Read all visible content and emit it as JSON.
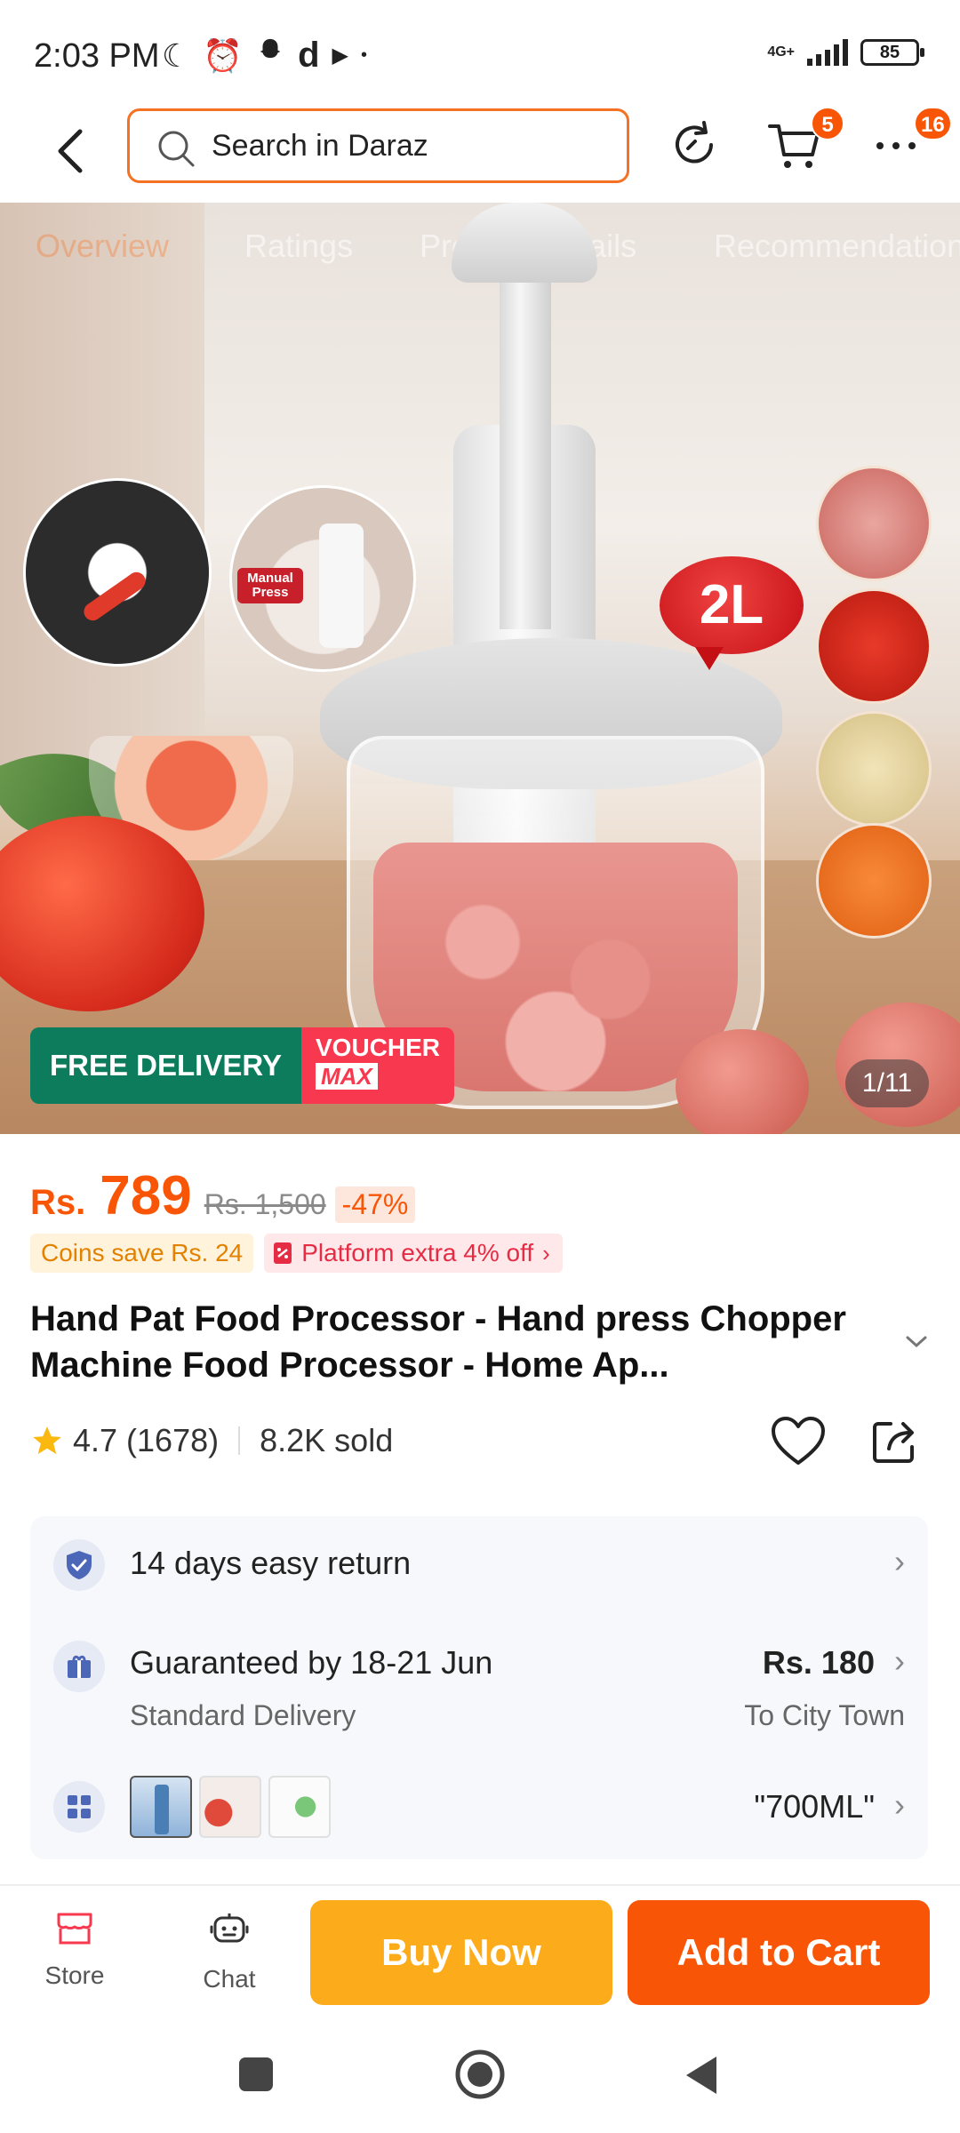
{
  "status_bar": {
    "time": "2:03 PM",
    "network": "4G+",
    "battery": "85"
  },
  "header": {
    "search_placeholder": "Search in Daraz",
    "cart_badge": "5",
    "more_badge": "16"
  },
  "hero": {
    "tabs": [
      "Overview",
      "Ratings",
      "Product Details",
      "Recommendations"
    ],
    "size_label": "2L",
    "inset_label": "Manual Press",
    "free_delivery": "FREE DELIVERY",
    "voucher": "VOUCHER",
    "voucher_max": "MAX",
    "image_counter": "1/11"
  },
  "price": {
    "currency": "Rs.",
    "value": "789",
    "original": "Rs. 1,500",
    "discount": "-47%"
  },
  "promos": {
    "coins": "Coins save Rs. 24",
    "platform": "Platform extra 4% off"
  },
  "product": {
    "title": "Hand Pat Food Processor -  Hand press Chopper Machine Food Processor - Home Ap...",
    "rating": "4.7",
    "rating_count": "(1678)",
    "sold": "8.2K sold"
  },
  "info_card": {
    "return_policy": "14 days easy return",
    "delivery_guarantee": "Guaranteed by 18-21 Jun",
    "delivery_type": "Standard Delivery",
    "delivery_fee": "Rs. 180",
    "delivery_location": "To City Town",
    "variant": "\"700ML\""
  },
  "bottom_bar": {
    "store": "Store",
    "chat": "Chat",
    "buy_now": "Buy Now",
    "add_to_cart": "Add to Cart"
  },
  "colors": {
    "brand_orange": "#f85606",
    "buy_yellow": "#fcac1a",
    "search_border": "#f57224"
  }
}
